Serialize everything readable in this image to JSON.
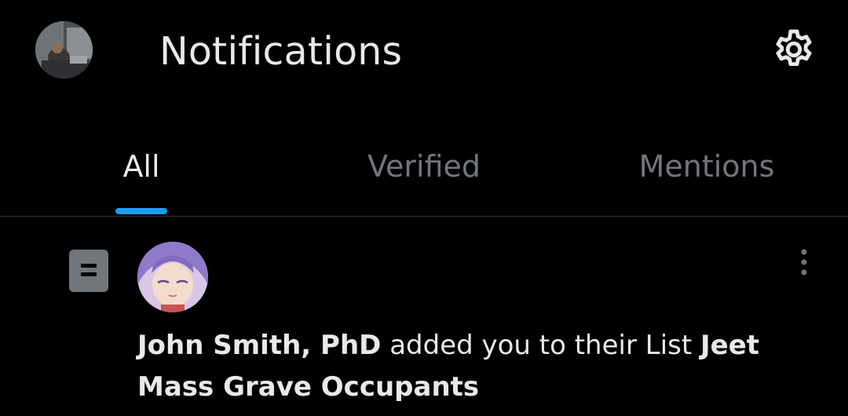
{
  "header": {
    "title": "Notifications",
    "avatar_icon": "profile-avatar",
    "settings_icon": "gear-icon"
  },
  "tabs": [
    {
      "label": "All",
      "active": true
    },
    {
      "label": "Verified",
      "active": false
    },
    {
      "label": "Mentions",
      "active": false
    }
  ],
  "colors": {
    "background": "#000000",
    "text_primary": "#e7e9ea",
    "text_secondary": "#71767b",
    "accent": "#1d9bf0",
    "divider": "#2f3336"
  },
  "notification": {
    "type_icon": "list-icon",
    "user_name": "John Smith, PhD",
    "action_text": " added you to their List ",
    "list_name": "Jeet Mass Grave Occupants",
    "more_icon": "more-vertical-icon"
  }
}
